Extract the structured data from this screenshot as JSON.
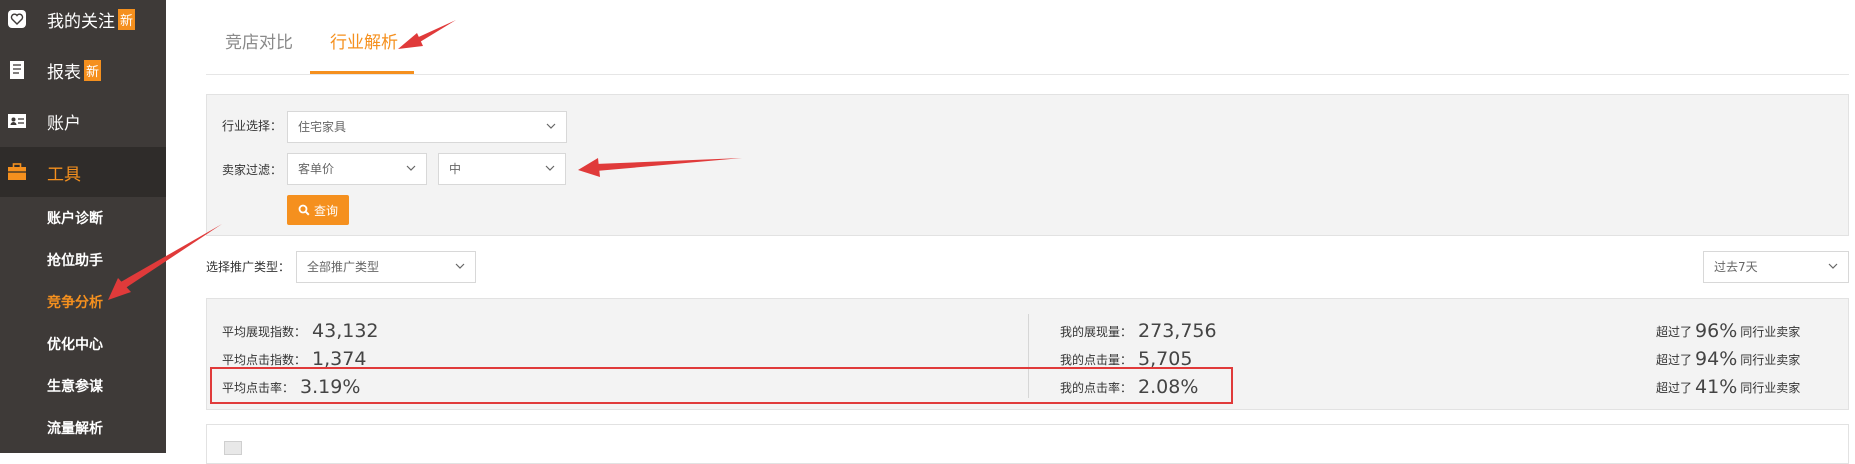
{
  "sidebar": {
    "items": [
      {
        "label": "我的关注",
        "badge": "新",
        "icon": "heart-icon"
      },
      {
        "label": "报表",
        "badge": "新",
        "icon": "report-icon"
      },
      {
        "label": "账户",
        "icon": "account-card-icon"
      },
      {
        "label": "工具",
        "icon": "briefcase-icon",
        "active": true
      }
    ],
    "sub_items": [
      "账户诊断",
      "抢位助手",
      "竞争分析",
      "优化中心",
      "生意参谋",
      "流量解析"
    ],
    "active_sub": "竞争分析"
  },
  "tabs": [
    {
      "label": "竞店对比"
    },
    {
      "label": "行业解析",
      "active": true
    }
  ],
  "filters": {
    "industry_label": "行业选择：",
    "industry_value": "住宅家具",
    "seller_label": "卖家过滤：",
    "seller_metric": "客单价",
    "seller_level": "中",
    "query_button": "查询"
  },
  "promo": {
    "label": "选择推广类型：",
    "value": "全部推广类型",
    "period": "过去7天"
  },
  "stats": {
    "avg_impression_label": "平均展现指数：",
    "avg_impression_value": "43,132",
    "avg_click_label": "平均点击指数：",
    "avg_click_value": "1,374",
    "avg_ctr_label": "平均点击率：",
    "avg_ctr_value": "3.19%",
    "my_impression_label": "我的展现量：",
    "my_impression_value": "273,756",
    "my_click_label": "我的点击量：",
    "my_click_value": "5,705",
    "my_ctr_label": "我的点击率：",
    "my_ctr_value": "2.08%",
    "exceed_prefix": "超过了",
    "exceed_suffix": "同行业卖家",
    "exceed_impression": "96%",
    "exceed_click": "94%",
    "exceed_ctr": "41%"
  },
  "colors": {
    "accent": "#f5901e",
    "sidebar_bg": "#3e3a38",
    "annotation_red": "#e03a3a"
  }
}
